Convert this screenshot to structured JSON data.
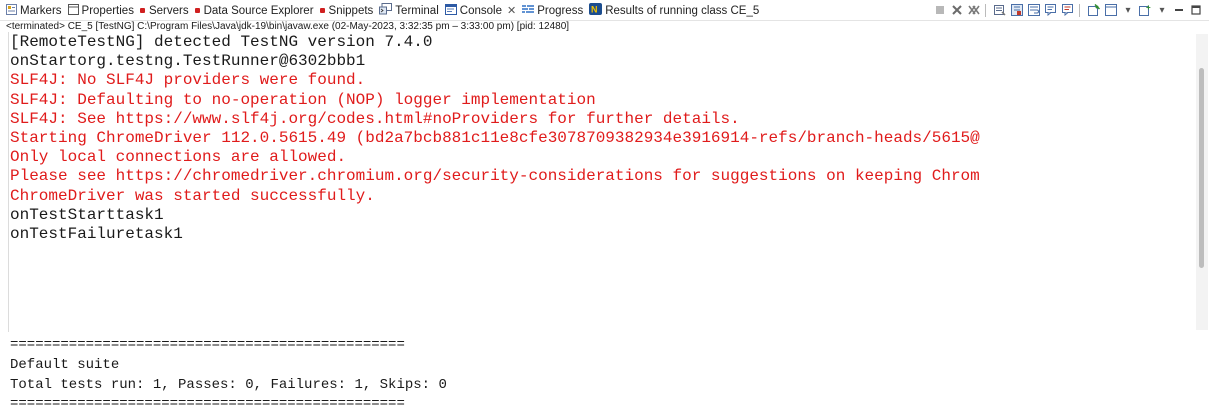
{
  "tabs": [
    {
      "label": "Markers",
      "icon": "markers-icon"
    },
    {
      "label": "Properties",
      "icon": "properties-icon"
    },
    {
      "label": "Servers",
      "icon": "servers-icon"
    },
    {
      "label": "Data Source Explorer",
      "icon": "data-source-icon"
    },
    {
      "label": "Snippets",
      "icon": "snippets-icon"
    },
    {
      "label": "Terminal",
      "icon": "terminal-icon"
    },
    {
      "label": "Console",
      "icon": "console-icon",
      "active": true
    },
    {
      "label": "Progress",
      "icon": "progress-icon"
    },
    {
      "label": "Results of running class CE_5",
      "icon": "testng-icon"
    }
  ],
  "status_line": "<terminated> CE_5 [TestNG] C:\\Program Files\\Java\\jdk-19\\bin\\javaw.exe  (02-May-2023, 3:32:35 pm – 3:33:00 pm) [pid: 12480]",
  "console_lines": [
    {
      "text": "[RemoteTestNG] detected TestNG version 7.4.0",
      "stream": "out"
    },
    {
      "text": "onStartorg.testng.TestRunner@6302bbb1",
      "stream": "out"
    },
    {
      "text": "SLF4J: No SLF4J providers were found.",
      "stream": "err"
    },
    {
      "text": "SLF4J: Defaulting to no-operation (NOP) logger implementation",
      "stream": "err"
    },
    {
      "text": "SLF4J: See https://www.slf4j.org/codes.html#noProviders for further details.",
      "stream": "err"
    },
    {
      "text": "Starting ChromeDriver 112.0.5615.49 (bd2a7bcb881c11e8cfe3078709382934e3916914-refs/branch-heads/5615@",
      "stream": "err"
    },
    {
      "text": "Only local connections are allowed.",
      "stream": "err"
    },
    {
      "text": "Please see https://chromedriver.chromium.org/security-considerations for suggestions on keeping Chrom",
      "stream": "err"
    },
    {
      "text": "ChromeDriver was started successfully.",
      "stream": "err"
    },
    {
      "text": "onTestStarttask1",
      "stream": "out"
    },
    {
      "text": "onTestFailuretask1",
      "stream": "out"
    }
  ],
  "results_lines": [
    "===============================================",
    "Default suite",
    "Total tests run: 1, Passes: 0, Failures: 1, Skips: 0",
    "==============================================="
  ],
  "colors": {
    "error": "#e01b1b",
    "output": "#1a1a1a"
  }
}
